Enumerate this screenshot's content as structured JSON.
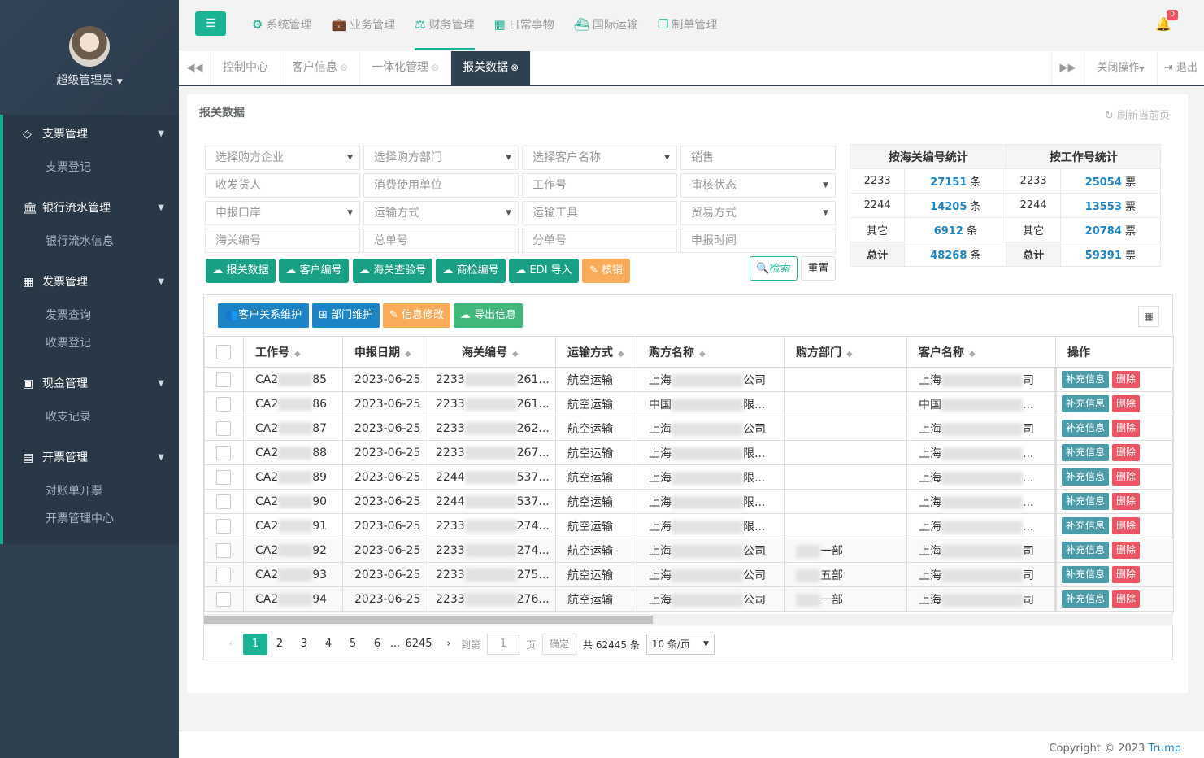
{
  "sidebar": {
    "username": "超级管理员",
    "groups": [
      {
        "label": "支票管理",
        "items": [
          "支票登记"
        ]
      },
      {
        "label": "银行流水管理",
        "items": [
          "银行流水信息"
        ]
      },
      {
        "label": "发票管理",
        "items": [
          "发票查询",
          "收票登记"
        ]
      },
      {
        "label": "现金管理",
        "items": [
          "收支记录"
        ]
      },
      {
        "label": "开票管理",
        "items": [
          "对账单开票",
          "开票管理中心"
        ]
      }
    ]
  },
  "topnav": {
    "items": [
      "系统管理",
      "业务管理",
      "财务管理",
      "日常事物",
      "国际运输",
      "制单管理"
    ],
    "active": "财务管理",
    "bell_count": "0"
  },
  "tabs": {
    "items": [
      "控制中心",
      "客户信息",
      "一体化管理",
      "报关数据"
    ],
    "active": "报关数据",
    "close_ops": "关闭操作",
    "logout": "退出"
  },
  "panel": {
    "title": "报关数据",
    "refresh": "刷新当前页"
  },
  "filters": {
    "row1": [
      "选择购方企业",
      "选择购方部门",
      "选择客户名称",
      "销售"
    ],
    "row2": [
      "收发货人",
      "消费使用单位",
      "工作号",
      "审核状态"
    ],
    "row3": [
      "申报口岸",
      "运输方式",
      "运输工具",
      "贸易方式"
    ],
    "row4": [
      "海关编号",
      "总单号",
      "分单号",
      "申报时间"
    ]
  },
  "actions": {
    "report": "报关数据",
    "cust": "客户编号",
    "customs": "海关查验号",
    "inspect": "商检编号",
    "edi": "EDI 导入",
    "verify": "核销",
    "search": "检索",
    "reset": "重置"
  },
  "stats": {
    "h1": "按海关编号统计",
    "h2": "按工作号统计",
    "rows": [
      {
        "k1": "2233",
        "v1": "27151",
        "u1": "条",
        "k2": "2233",
        "v2": "25054",
        "u2": "票"
      },
      {
        "k1": "2244",
        "v1": "14205",
        "u1": "条",
        "k2": "2244",
        "v2": "13553",
        "u2": "票"
      },
      {
        "k1": "其它",
        "v1": "6912",
        "u1": "条",
        "k2": "其它",
        "v2": "20784",
        "u2": "票"
      },
      {
        "k1": "总计",
        "v1": "48268",
        "u1": "条",
        "k2": "总计",
        "v2": "59391",
        "u2": "票"
      }
    ]
  },
  "toolbar": {
    "rel": "客户关系维护",
    "dept": "部门维护",
    "edit": "信息修改",
    "export": "导出信息"
  },
  "grid": {
    "headers": [
      "工作号",
      "申报日期",
      "海关编号",
      "运输方式",
      "购方名称",
      "购方部门",
      "客户名称",
      "操作"
    ],
    "supplement": "补充信息",
    "delete": "删除",
    "rows": [
      {
        "a": "CA2",
        "b": "85",
        "date": "2023-06-25",
        "c": "2233",
        "d": "261...",
        "mode": "航空运输",
        "e": "上海",
        "f": "公司",
        "dept": "",
        "g": "上海",
        "h": "司"
      },
      {
        "a": "CA2",
        "b": "86",
        "date": "2023-06-25",
        "c": "2233",
        "d": "261...",
        "mode": "航空运输",
        "e": "中国",
        "f": "限...",
        "dept": "",
        "g": "中国",
        "h": "..."
      },
      {
        "a": "CA2",
        "b": "87",
        "date": "2023-06-25",
        "c": "2233",
        "d": "262...",
        "mode": "航空运输",
        "e": "上海",
        "f": "公司",
        "dept": "",
        "g": "上海",
        "h": "司"
      },
      {
        "a": "CA2",
        "b": "88",
        "date": "2023-06-25",
        "c": "2233",
        "d": "267...",
        "mode": "航空运输",
        "e": "上海",
        "f": "限...",
        "dept": "",
        "g": "上海",
        "h": "..."
      },
      {
        "a": "CA2",
        "b": "89",
        "date": "2023-06-25",
        "c": "2244",
        "d": "537...",
        "mode": "航空运输",
        "e": "上海",
        "f": "限...",
        "dept": "",
        "g": "上海",
        "h": "..."
      },
      {
        "a": "CA2",
        "b": "90",
        "date": "2023-06-25",
        "c": "2244",
        "d": "537...",
        "mode": "航空运输",
        "e": "上海",
        "f": "限...",
        "dept": "",
        "g": "上海",
        "h": "..."
      },
      {
        "a": "CA2",
        "b": "91",
        "date": "2023-06-25",
        "c": "2233",
        "d": "274...",
        "mode": "航空运输",
        "e": "上海",
        "f": "限...",
        "dept": "",
        "g": "上海",
        "h": "..."
      },
      {
        "a": "CA2",
        "b": "92",
        "date": "2023-06-25",
        "c": "2233",
        "d": "274...",
        "mode": "航空运输",
        "e": "上海",
        "f": "公司",
        "dept": "一部",
        "g": "上海",
        "h": "司"
      },
      {
        "a": "CA2",
        "b": "93",
        "date": "2023-06-25",
        "c": "2233",
        "d": "275...",
        "mode": "航空运输",
        "e": "上海",
        "f": "公司",
        "dept": "五部",
        "g": "上海",
        "h": "司"
      },
      {
        "a": "CA2",
        "b": "94",
        "date": "2023-06-25",
        "c": "2233",
        "d": "276...",
        "mode": "航空运输",
        "e": "上海",
        "f": "公司",
        "dept": "一部",
        "g": "上海",
        "h": "司"
      }
    ]
  },
  "pager": {
    "pages": [
      "1",
      "2",
      "3",
      "4",
      "5",
      "6",
      "...",
      "6245"
    ],
    "goto": "到第",
    "page_val": "1",
    "page_unit": "页",
    "confirm": "确定",
    "total": "共 62445 条",
    "size": "10 条/页"
  },
  "footer": {
    "text": "Copyright © 2023",
    "brand": "Trump"
  }
}
